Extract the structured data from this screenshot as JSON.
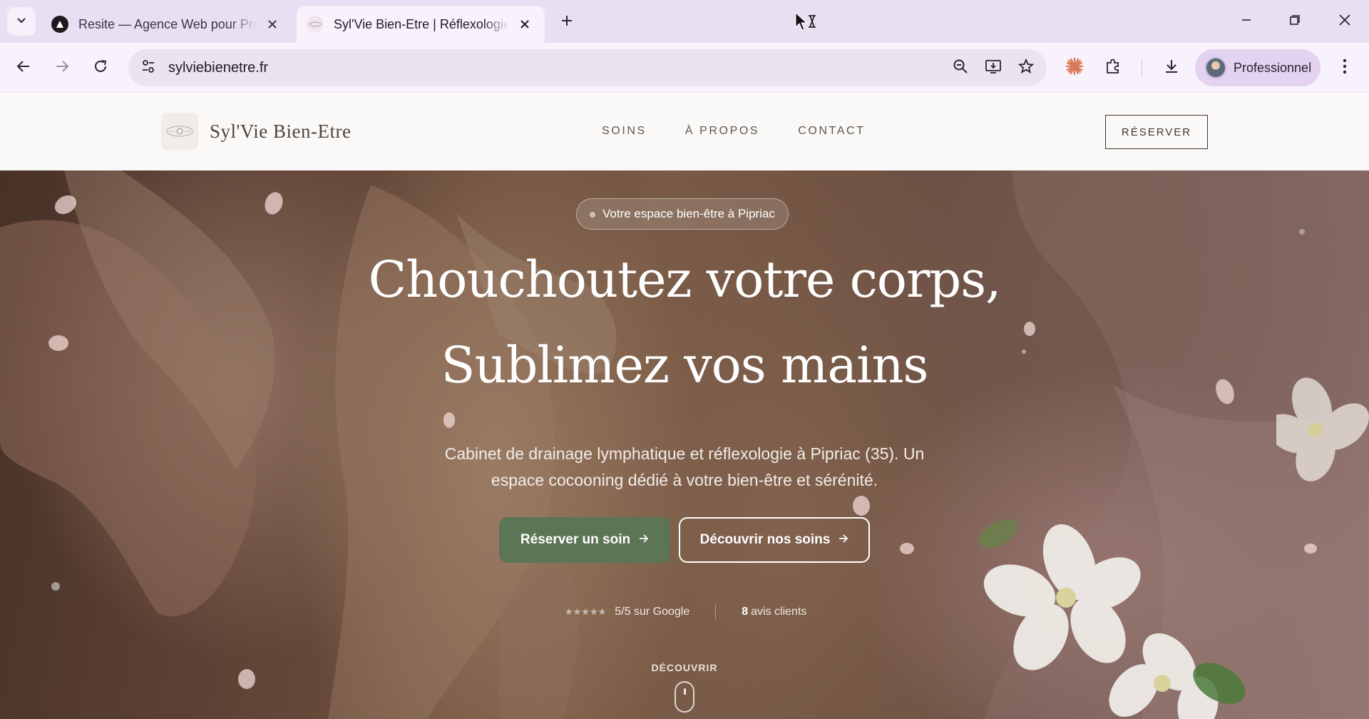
{
  "browser": {
    "tabs": [
      {
        "title": "Resite — Agence Web pour Pro",
        "active": false
      },
      {
        "title": "Syl'Vie Bien-Etre | Réflexologie & Drainage",
        "active": true
      }
    ],
    "url": "sylviebienetre.fr",
    "profile_name": "Professionnel"
  },
  "site": {
    "brand": "Syl'Vie Bien-Etre",
    "nav": [
      "SOINS",
      "À PROPOS",
      "CONTACT"
    ],
    "reserve_label": "RÉSERVER"
  },
  "hero": {
    "badge": "Votre espace bien-être à Pipriac",
    "title_line1": "Chouchoutez votre corps,",
    "title_line2": "Sublimez vos mains",
    "subtitle": "Cabinet de drainage lymphatique et réflexologie à Pipriac (35). Un espace cocooning dédié à votre bien-être et sérénité.",
    "primary_cta": "Réserver un soin",
    "secondary_cta": "Découvrir nos soins",
    "stars": "★★★★★",
    "rating_text": "5/5 sur Google",
    "reviews_count": "8",
    "reviews_label": "avis clients",
    "discover_label": "DÉCOUVRIR"
  },
  "colors": {
    "primary_button": "#5c7555",
    "tabbar_bg": "#e9dff2",
    "header_bg": "#fbf9f7"
  }
}
